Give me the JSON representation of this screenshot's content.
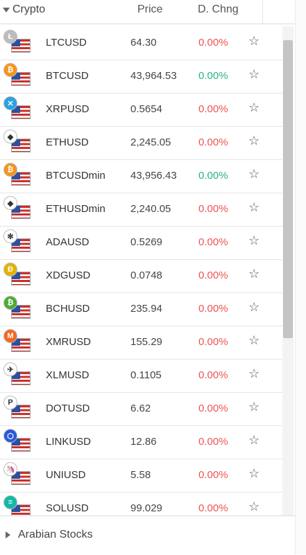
{
  "header": {
    "title": "Crypto",
    "price_label": "Price",
    "change_label": "D. Chng"
  },
  "colors": {
    "up": "#2bb08a",
    "down": "#f05252"
  },
  "rows": [
    {
      "symbol": "LTCUSD",
      "price": "64.30",
      "change": "0.00%",
      "dir": "down",
      "coin_icon": "litecoin-icon",
      "coin_color": "#bcbcbc",
      "coin_glyph": "Ł"
    },
    {
      "symbol": "BTCUSD",
      "price": "43,964.53",
      "change": "0.00%",
      "dir": "up",
      "coin_icon": "bitcoin-icon",
      "coin_color": "#f7931a",
      "coin_glyph": "₿"
    },
    {
      "symbol": "XRPUSD",
      "price": "0.5654",
      "change": "0.00%",
      "dir": "down",
      "coin_icon": "ripple-icon",
      "coin_color": "#2aa3df",
      "coin_glyph": "✕"
    },
    {
      "symbol": "ETHUSD",
      "price": "2,245.05",
      "change": "0.00%",
      "dir": "down",
      "coin_icon": "ethereum-icon",
      "coin_color": "#ffffff",
      "coin_glyph": "◆"
    },
    {
      "symbol": "BTCUSDmin",
      "price": "43,956.43",
      "change": "0.00%",
      "dir": "up",
      "coin_icon": "bitcoin-icon",
      "coin_color": "#f7931a",
      "coin_glyph": "₿"
    },
    {
      "symbol": "ETHUSDmin",
      "price": "2,240.05",
      "change": "0.00%",
      "dir": "down",
      "coin_icon": "ethereum-icon",
      "coin_color": "#ffffff",
      "coin_glyph": "◆"
    },
    {
      "symbol": "ADAUSD",
      "price": "0.5269",
      "change": "0.00%",
      "dir": "down",
      "coin_icon": "cardano-icon",
      "coin_color": "#ffffff",
      "coin_glyph": "✻"
    },
    {
      "symbol": "XDGUSD",
      "price": "0.0748",
      "change": "0.00%",
      "dir": "down",
      "coin_icon": "dogecoin-icon",
      "coin_color": "#e1b303",
      "coin_glyph": "Ð"
    },
    {
      "symbol": "BCHUSD",
      "price": "235.94",
      "change": "0.00%",
      "dir": "down",
      "coin_icon": "bitcoin-cash-icon",
      "coin_color": "#4cab35",
      "coin_glyph": "₿"
    },
    {
      "symbol": "XMRUSD",
      "price": "155.29",
      "change": "0.00%",
      "dir": "down",
      "coin_icon": "monero-icon",
      "coin_color": "#f26822",
      "coin_glyph": "M"
    },
    {
      "symbol": "XLMUSD",
      "price": "0.1105",
      "change": "0.00%",
      "dir": "down",
      "coin_icon": "stellar-icon",
      "coin_color": "#ffffff",
      "coin_glyph": "✈"
    },
    {
      "symbol": "DOTUSD",
      "price": "6.62",
      "change": "0.00%",
      "dir": "down",
      "coin_icon": "polkadot-icon",
      "coin_color": "#ffffff",
      "coin_glyph": "P"
    },
    {
      "symbol": "LINKUSD",
      "price": "12.86",
      "change": "0.00%",
      "dir": "down",
      "coin_icon": "chainlink-icon",
      "coin_color": "#2a5ada",
      "coin_glyph": "⬡"
    },
    {
      "symbol": "UNIUSD",
      "price": "5.58",
      "change": "0.00%",
      "dir": "down",
      "coin_icon": "uniswap-icon",
      "coin_color": "#ffffff",
      "coin_glyph": "🦄"
    },
    {
      "symbol": "SOLUSD",
      "price": "99.029",
      "change": "0.00%",
      "dir": "down",
      "coin_icon": "solana-icon",
      "coin_color": "#14b8a6",
      "coin_glyph": "≡"
    }
  ],
  "footer": {
    "title": "Arabian Stocks"
  }
}
